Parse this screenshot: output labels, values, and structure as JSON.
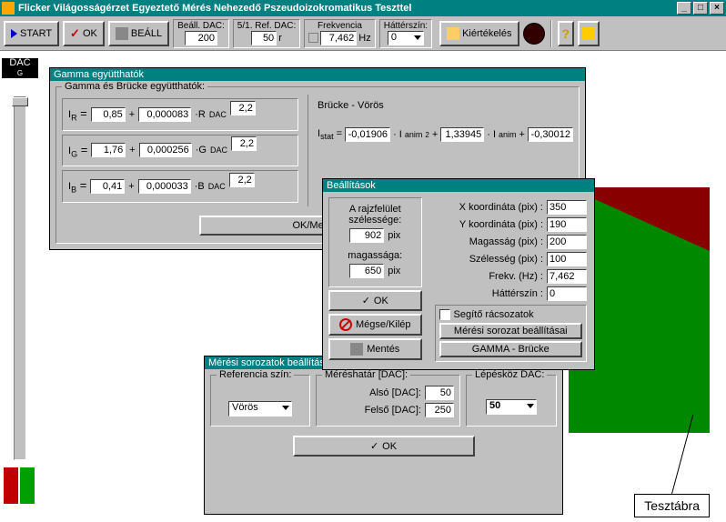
{
  "title": "Flicker Világosságérzet Egyeztető Mérés Nehezedő Pszeudoizokromatikus Teszttel",
  "toolbar": {
    "start": "START",
    "ok": "OK",
    "beall": "BEÁLL",
    "beall_dac_lbl": "Beáll. DAC:",
    "beall_dac_val": "200",
    "ref_dac_lbl": "5/1. Ref. DAC:",
    "ref_dac_val": "50",
    "ref_dac_unit": "r",
    "freq_lbl": "Frekvencia",
    "freq_val": "7,462",
    "freq_unit": "Hz",
    "bg_lbl": "Háttérszín:",
    "bg_val": "0",
    "kiert": "Kiértékelés"
  },
  "dac_badge": "DAC",
  "dac_sub": "G",
  "gamma": {
    "hdr": "Gamma együtthatók",
    "title": "Gamma és Brücke együtthatók:",
    "r_pre": "I",
    "r_sub": "R",
    "r_a": "0,85",
    "r_b": "0,000083",
    "r_c": "2,2",
    "r_mid": "·R",
    "g_sub": "G",
    "g_a": "1,76",
    "g_b": "0,000256",
    "g_c": "2,2",
    "g_mid": "·G",
    "b_sub": "B",
    "b_a": "0,41",
    "b_b": "0,000033",
    "b_c": "2,2",
    "b_mid": "·B",
    "dac_sfx": "DAC",
    "ok_mentes": "OK/Mentés",
    "brucke_lbl": "Brücke - Vörös",
    "br_pre": "I",
    "br_sub": "stat",
    "br_a": "-0,01906",
    "br_mid1": "· I",
    "br_sub2": "anim",
    "br_sup": "2",
    "br_b": "1,33945",
    "br_mid2": "· I",
    "br_c": "-0,30012"
  },
  "settings": {
    "hdr": "Beállítások",
    "surf_w_lbl": "A rajzfelület szélessége:",
    "surf_w": "902",
    "pix": "pix",
    "surf_h_lbl": "magassága:",
    "surf_h": "650",
    "ok": "OK",
    "cancel": "Mégse/Kilép",
    "save": "Mentés",
    "xcoord_lbl": "X koordináta (pix) :",
    "xcoord": "350",
    "ycoord_lbl": "Y koordináta (pix) :",
    "ycoord": "190",
    "height_lbl": "Magasság (pix) :",
    "height": "200",
    "width_lbl": "Szélesség (pix) :",
    "width": "100",
    "freq_lbl": "Frekv. (Hz) :",
    "freq": "7,462",
    "bg_lbl": "Háttérszín :",
    "bg": "0",
    "grid_lbl": "Segítő rácsozatok",
    "series_btn": "Mérési sorozat beállításai",
    "gamma_btn": "GAMMA - Brücke"
  },
  "series": {
    "hdr": "Mérési sorozatok beállítás",
    "ref_lbl": "Referencia szín:",
    "ref_val": "Vörös",
    "limit_lbl": "Méréshatár [DAC]:",
    "lower_lbl": "Alsó [DAC]:",
    "lower": "50",
    "upper_lbl": "Felső [DAC]:",
    "upper": "250",
    "step_lbl": "Lépésköz DAC:",
    "step": "50",
    "ok": "OK"
  },
  "test_label": "Tesztábra"
}
